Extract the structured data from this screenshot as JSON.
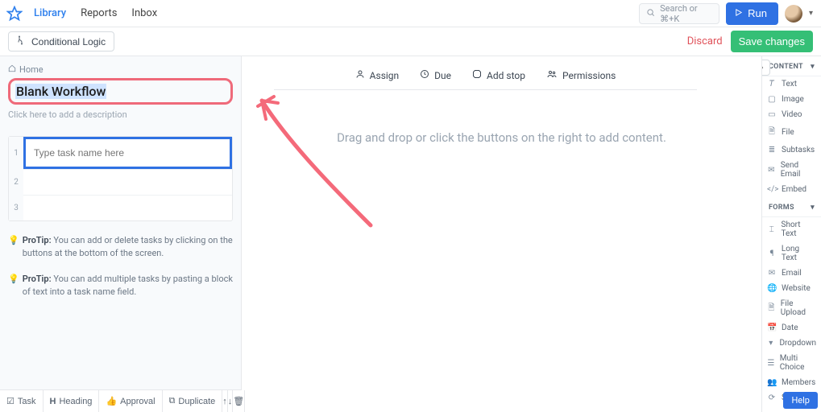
{
  "nav": {
    "library": "Library",
    "reports": "Reports",
    "inbox": "Inbox"
  },
  "search": {
    "placeholder": "Search or ⌘+K"
  },
  "run": {
    "label": "Run"
  },
  "actionbar": {
    "conditional": "Conditional Logic",
    "discard": "Discard",
    "save": "Save changes"
  },
  "breadcrumb": {
    "home": "Home"
  },
  "workflow": {
    "title": "Blank Workflow",
    "desc_placeholder": "Click here to add a description"
  },
  "task": {
    "placeholder": "Type task name here"
  },
  "protips": {
    "label": "ProTip:",
    "p1": "You can add or delete tasks by clicking on the buttons at the bottom of the screen.",
    "p2": "You can add multiple tasks by pasting a block of text into a task name field."
  },
  "bottombar": {
    "task": "Task",
    "heading": "Heading",
    "approval": "Approval",
    "duplicate": "Duplicate"
  },
  "ctabs": {
    "assign": "Assign",
    "due": "Due",
    "addstop": "Add stop",
    "permissions": "Permissions"
  },
  "empty": {
    "msg": "Drag and drop or click the buttons on the right to add content."
  },
  "rside": {
    "content_label": "CONTENT",
    "forms_label": "FORMS",
    "content": [
      "Text",
      "Image",
      "Video",
      "File",
      "Subtasks",
      "Send Email",
      "Embed"
    ],
    "forms": [
      "Short Text",
      "Long Text",
      "Email",
      "Website",
      "File Upload",
      "Date",
      "Dropdown",
      "Multi Choice",
      "Members",
      "Snippet"
    ]
  },
  "help": {
    "label": "Help"
  }
}
